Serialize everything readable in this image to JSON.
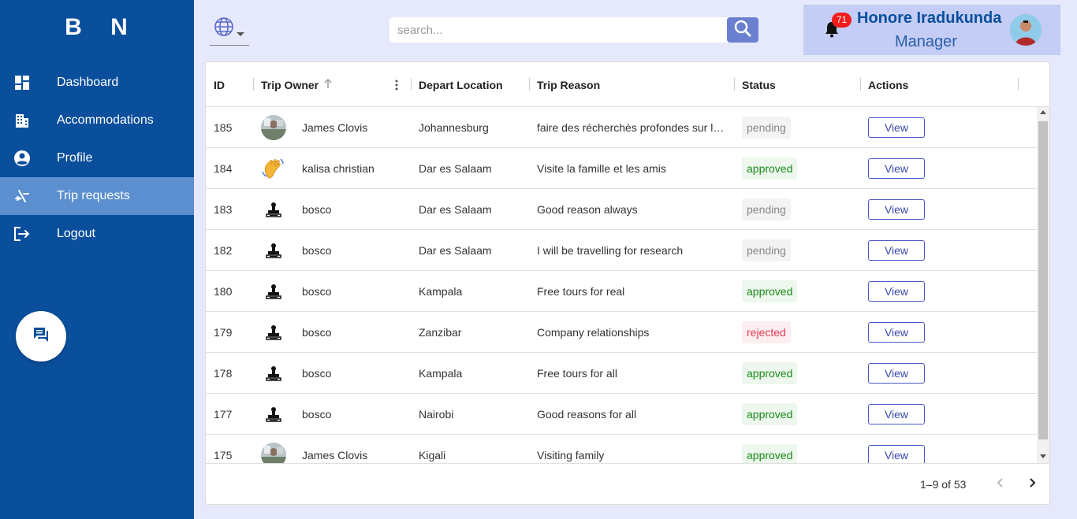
{
  "sidebar": {
    "brand": "B N",
    "items": [
      {
        "label": "Dashboard",
        "icon": "dashboard-icon"
      },
      {
        "label": "Accommodations",
        "icon": "building-icon"
      },
      {
        "label": "Profile",
        "icon": "account-circle-icon"
      },
      {
        "label": "Trip requests",
        "icon": "trip-icon",
        "active": true
      },
      {
        "label": "Logout",
        "icon": "logout-icon"
      }
    ],
    "chat_icon": "chat-icon"
  },
  "header": {
    "search_placeholder": "search...",
    "notification_count": "71",
    "user_name": "Honore Iradukunda",
    "user_role": "Manager"
  },
  "table": {
    "columns": [
      "ID",
      "Trip Owner",
      "Depart Location",
      "Trip Reason",
      "Status",
      "Actions"
    ],
    "rows": [
      {
        "id": "185",
        "owner": "James Clovis",
        "avatar": "photo",
        "depart": "Johannesburg",
        "reason": "faire des récherchès profondes sur l…",
        "status": "pending",
        "action": "View"
      },
      {
        "id": "184",
        "owner": "kalisa christian",
        "avatar": "wave",
        "depart": "Dar es Salaam",
        "reason": "Visite la famille et les amis",
        "status": "approved",
        "action": "View"
      },
      {
        "id": "183",
        "owner": "bosco",
        "avatar": "stamp",
        "depart": "Dar es Salaam",
        "reason": "Good reason always",
        "status": "pending",
        "action": "View"
      },
      {
        "id": "182",
        "owner": "bosco",
        "avatar": "stamp",
        "depart": "Dar es Salaam",
        "reason": "I will be travelling for research",
        "status": "pending",
        "action": "View"
      },
      {
        "id": "180",
        "owner": "bosco",
        "avatar": "stamp",
        "depart": "Kampala",
        "reason": "Free tours for real",
        "status": "approved",
        "action": "View"
      },
      {
        "id": "179",
        "owner": "bosco",
        "avatar": "stamp",
        "depart": "Zanzibar",
        "reason": "Company relationships",
        "status": "rejected",
        "action": "View"
      },
      {
        "id": "178",
        "owner": "bosco",
        "avatar": "stamp",
        "depart": "Kampala",
        "reason": "Free tours for all",
        "status": "approved",
        "action": "View"
      },
      {
        "id": "177",
        "owner": "bosco",
        "avatar": "stamp",
        "depart": "Nairobi",
        "reason": "Good reasons for all",
        "status": "approved",
        "action": "View"
      },
      {
        "id": "175",
        "owner": "James Clovis",
        "avatar": "photo",
        "depart": "Kigali",
        "reason": "Visiting family",
        "status": "approved",
        "action": "View"
      }
    ]
  },
  "pagination": {
    "range": "1–9 of 53"
  },
  "colors": {
    "sidebar_bg": "#0a4f9c",
    "active_item_bg": "#5b8fd0",
    "page_bg": "#e6e8fb",
    "user_box_bg": "#c3cdf6",
    "approved": "#1a8a1a",
    "rejected": "#e53955",
    "pending": "#888888"
  }
}
